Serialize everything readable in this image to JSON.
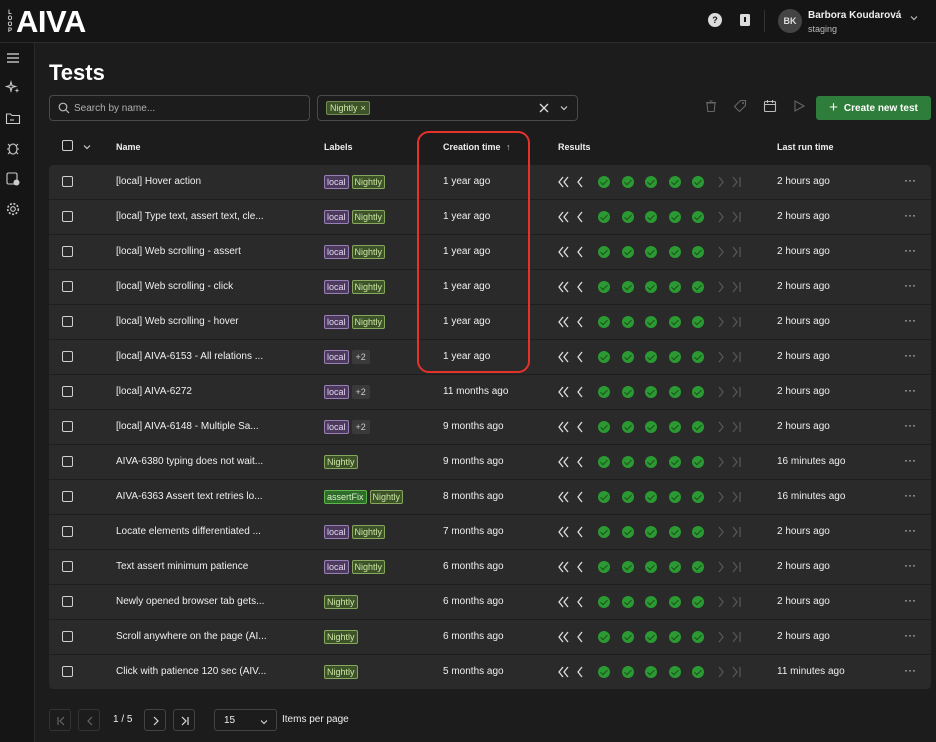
{
  "app": {
    "logo_text": "AIVA",
    "logo_side_letters": [
      "L",
      "O",
      "O",
      "P"
    ]
  },
  "header": {
    "help_icon": "help-icon",
    "docs_icon": "book-icon",
    "user_initials": "BK",
    "user_name": "Barbora Koudarová",
    "environment": "staging"
  },
  "sidebar": {
    "items": [
      {
        "icon": "menu-icon"
      },
      {
        "icon": "sparkle-icon"
      },
      {
        "icon": "folder-icon"
      },
      {
        "icon": "bug-icon"
      },
      {
        "icon": "test-run-icon"
      },
      {
        "icon": "settings-icon"
      }
    ]
  },
  "page": {
    "title": "Tests"
  },
  "search": {
    "placeholder": "Search by name..."
  },
  "label_filter": {
    "selected": "Nightly",
    "remove_glyph": "×"
  },
  "toolbar": {
    "create_label": "Create new test",
    "create_icon": "plus-icon"
  },
  "columns": {
    "name": "Name",
    "labels": "Labels",
    "creation_time": "Creation time",
    "sort_indicator": "↑",
    "results": "Results",
    "last_run": "Last run time"
  },
  "rows": [
    {
      "name": "[local] Hover action",
      "labels": [
        "local",
        "Nightly"
      ],
      "more": "",
      "created": "1 year ago",
      "last_run": "2 hours ago"
    },
    {
      "name": "[local] Type text, assert text, cle...",
      "labels": [
        "local",
        "Nightly"
      ],
      "more": "",
      "created": "1 year ago",
      "last_run": "2 hours ago"
    },
    {
      "name": "[local] Web scrolling - assert",
      "labels": [
        "local",
        "Nightly"
      ],
      "more": "",
      "created": "1 year ago",
      "last_run": "2 hours ago"
    },
    {
      "name": "[local] Web scrolling - click",
      "labels": [
        "local",
        "Nightly"
      ],
      "more": "",
      "created": "1 year ago",
      "last_run": "2 hours ago"
    },
    {
      "name": "[local] Web scrolling - hover",
      "labels": [
        "local",
        "Nightly"
      ],
      "more": "",
      "created": "1 year ago",
      "last_run": "2 hours ago"
    },
    {
      "name": "[local] AIVA-6153 - All relations ...",
      "labels": [
        "local"
      ],
      "more": "+2",
      "created": "1 year ago",
      "last_run": "2 hours ago"
    },
    {
      "name": "[local] AIVA-6272",
      "labels": [
        "local"
      ],
      "more": "+2",
      "created": "11 months ago",
      "last_run": "2 hours ago"
    },
    {
      "name": "[local] AIVA-6148 - Multiple Sa...",
      "labels": [
        "local"
      ],
      "more": "+2",
      "created": "9 months ago",
      "last_run": "2 hours ago"
    },
    {
      "name": "AIVA-6380 typing does not wait...",
      "labels": [
        "Nightly"
      ],
      "more": "",
      "created": "9 months ago",
      "last_run": "16 minutes ago"
    },
    {
      "name": "AIVA-6363 Assert text retries lo...",
      "labels": [
        "assertFix",
        "Nightly"
      ],
      "more": "",
      "created": "8 months ago",
      "last_run": "16 minutes ago"
    },
    {
      "name": "Locate elements differentiated ...",
      "labels": [
        "local",
        "Nightly"
      ],
      "more": "",
      "created": "7 months ago",
      "last_run": "2 hours ago"
    },
    {
      "name": "Text assert minimum patience",
      "labels": [
        "local",
        "Nightly"
      ],
      "more": "",
      "created": "6 months ago",
      "last_run": "2 hours ago"
    },
    {
      "name": "Newly opened browser tab gets...",
      "labels": [
        "Nightly"
      ],
      "more": "",
      "created": "6 months ago",
      "last_run": "2 hours ago"
    },
    {
      "name": "Scroll anywhere on the page (AI...",
      "labels": [
        "Nightly"
      ],
      "more": "",
      "created": "6 months ago",
      "last_run": "2 hours ago"
    },
    {
      "name": "Click with patience 120 sec (AIV...",
      "labels": [
        "Nightly"
      ],
      "more": "",
      "created": "5 months ago",
      "last_run": "11 minutes ago"
    }
  ],
  "results_status": [
    "passed",
    "passed",
    "passed",
    "passed",
    "passed"
  ],
  "row_menu_glyph": "···",
  "pagination": {
    "page_text": "1 / 5",
    "per_page": "15",
    "per_page_label": "Items per page"
  },
  "colors": {
    "background": "#1c1c1c",
    "row_background": "#2a2a2a",
    "accent_green": "#2f7d3a",
    "pass_green": "#2c9a33",
    "highlight_red": "#e5322b",
    "tag_local": "#4b3a5c",
    "tag_nightly": "#3d5229"
  }
}
